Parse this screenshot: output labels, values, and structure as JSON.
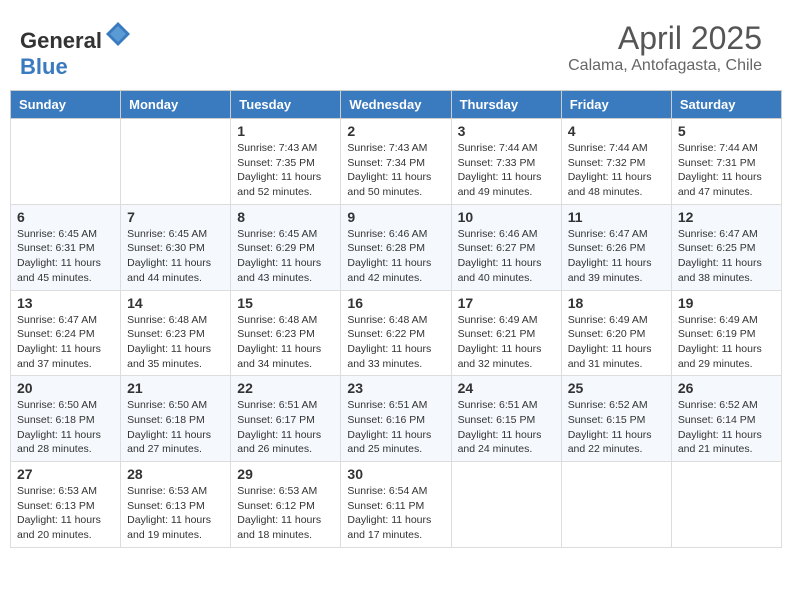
{
  "header": {
    "logo_general": "General",
    "logo_blue": "Blue",
    "title": "April 2025",
    "location": "Calama, Antofagasta, Chile"
  },
  "days_of_week": [
    "Sunday",
    "Monday",
    "Tuesday",
    "Wednesday",
    "Thursday",
    "Friday",
    "Saturday"
  ],
  "weeks": [
    [
      {
        "day": "",
        "info": ""
      },
      {
        "day": "",
        "info": ""
      },
      {
        "day": "1",
        "info": "Sunrise: 7:43 AM\nSunset: 7:35 PM\nDaylight: 11 hours and 52 minutes."
      },
      {
        "day": "2",
        "info": "Sunrise: 7:43 AM\nSunset: 7:34 PM\nDaylight: 11 hours and 50 minutes."
      },
      {
        "day": "3",
        "info": "Sunrise: 7:44 AM\nSunset: 7:33 PM\nDaylight: 11 hours and 49 minutes."
      },
      {
        "day": "4",
        "info": "Sunrise: 7:44 AM\nSunset: 7:32 PM\nDaylight: 11 hours and 48 minutes."
      },
      {
        "day": "5",
        "info": "Sunrise: 7:44 AM\nSunset: 7:31 PM\nDaylight: 11 hours and 47 minutes."
      }
    ],
    [
      {
        "day": "6",
        "info": "Sunrise: 6:45 AM\nSunset: 6:31 PM\nDaylight: 11 hours and 45 minutes."
      },
      {
        "day": "7",
        "info": "Sunrise: 6:45 AM\nSunset: 6:30 PM\nDaylight: 11 hours and 44 minutes."
      },
      {
        "day": "8",
        "info": "Sunrise: 6:45 AM\nSunset: 6:29 PM\nDaylight: 11 hours and 43 minutes."
      },
      {
        "day": "9",
        "info": "Sunrise: 6:46 AM\nSunset: 6:28 PM\nDaylight: 11 hours and 42 minutes."
      },
      {
        "day": "10",
        "info": "Sunrise: 6:46 AM\nSunset: 6:27 PM\nDaylight: 11 hours and 40 minutes."
      },
      {
        "day": "11",
        "info": "Sunrise: 6:47 AM\nSunset: 6:26 PM\nDaylight: 11 hours and 39 minutes."
      },
      {
        "day": "12",
        "info": "Sunrise: 6:47 AM\nSunset: 6:25 PM\nDaylight: 11 hours and 38 minutes."
      }
    ],
    [
      {
        "day": "13",
        "info": "Sunrise: 6:47 AM\nSunset: 6:24 PM\nDaylight: 11 hours and 37 minutes."
      },
      {
        "day": "14",
        "info": "Sunrise: 6:48 AM\nSunset: 6:23 PM\nDaylight: 11 hours and 35 minutes."
      },
      {
        "day": "15",
        "info": "Sunrise: 6:48 AM\nSunset: 6:23 PM\nDaylight: 11 hours and 34 minutes."
      },
      {
        "day": "16",
        "info": "Sunrise: 6:48 AM\nSunset: 6:22 PM\nDaylight: 11 hours and 33 minutes."
      },
      {
        "day": "17",
        "info": "Sunrise: 6:49 AM\nSunset: 6:21 PM\nDaylight: 11 hours and 32 minutes."
      },
      {
        "day": "18",
        "info": "Sunrise: 6:49 AM\nSunset: 6:20 PM\nDaylight: 11 hours and 31 minutes."
      },
      {
        "day": "19",
        "info": "Sunrise: 6:49 AM\nSunset: 6:19 PM\nDaylight: 11 hours and 29 minutes."
      }
    ],
    [
      {
        "day": "20",
        "info": "Sunrise: 6:50 AM\nSunset: 6:18 PM\nDaylight: 11 hours and 28 minutes."
      },
      {
        "day": "21",
        "info": "Sunrise: 6:50 AM\nSunset: 6:18 PM\nDaylight: 11 hours and 27 minutes."
      },
      {
        "day": "22",
        "info": "Sunrise: 6:51 AM\nSunset: 6:17 PM\nDaylight: 11 hours and 26 minutes."
      },
      {
        "day": "23",
        "info": "Sunrise: 6:51 AM\nSunset: 6:16 PM\nDaylight: 11 hours and 25 minutes."
      },
      {
        "day": "24",
        "info": "Sunrise: 6:51 AM\nSunset: 6:15 PM\nDaylight: 11 hours and 24 minutes."
      },
      {
        "day": "25",
        "info": "Sunrise: 6:52 AM\nSunset: 6:15 PM\nDaylight: 11 hours and 22 minutes."
      },
      {
        "day": "26",
        "info": "Sunrise: 6:52 AM\nSunset: 6:14 PM\nDaylight: 11 hours and 21 minutes."
      }
    ],
    [
      {
        "day": "27",
        "info": "Sunrise: 6:53 AM\nSunset: 6:13 PM\nDaylight: 11 hours and 20 minutes."
      },
      {
        "day": "28",
        "info": "Sunrise: 6:53 AM\nSunset: 6:13 PM\nDaylight: 11 hours and 19 minutes."
      },
      {
        "day": "29",
        "info": "Sunrise: 6:53 AM\nSunset: 6:12 PM\nDaylight: 11 hours and 18 minutes."
      },
      {
        "day": "30",
        "info": "Sunrise: 6:54 AM\nSunset: 6:11 PM\nDaylight: 11 hours and 17 minutes."
      },
      {
        "day": "",
        "info": ""
      },
      {
        "day": "",
        "info": ""
      },
      {
        "day": "",
        "info": ""
      }
    ]
  ]
}
